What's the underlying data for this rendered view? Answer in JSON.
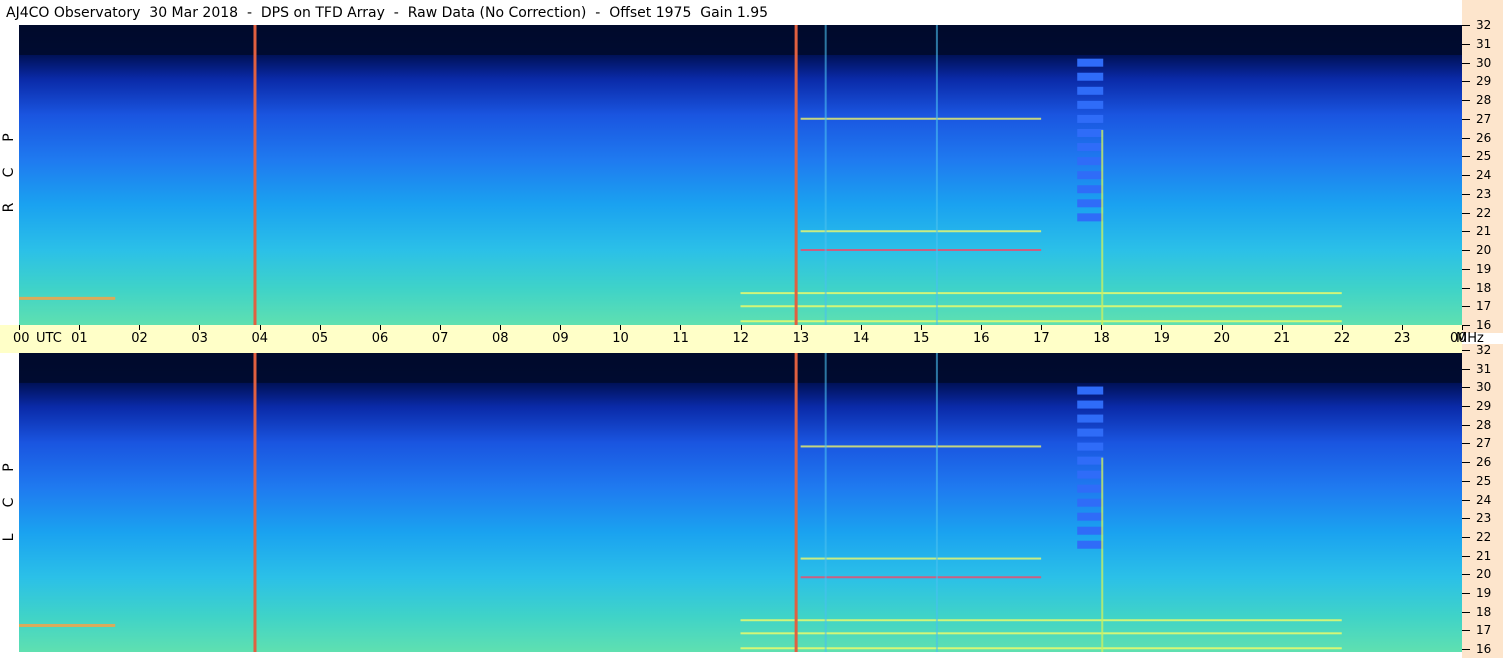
{
  "title": "AJ4CO Observatory  30 Mar 2018  -  DPS on TFD Array  -  Raw Data (No Correction)  -  Offset 1975  Gain 1.95",
  "panels": [
    {
      "polarization": "R C P",
      "letters": [
        "R",
        "C",
        "P"
      ]
    },
    {
      "polarization": "L C P",
      "letters": [
        "L",
        "C",
        "P"
      ]
    }
  ],
  "chart_data": {
    "type": "heatmap",
    "title": "AJ4CO Observatory  30 Mar 2018  -  DPS on TFD Array  -  Raw Data (No Correction)  -  Offset 1975  Gain 1.95",
    "x_axis": {
      "unit_label": "UTC",
      "range_hours": [
        0,
        24
      ],
      "tick_labels": [
        "00",
        "01",
        "02",
        "03",
        "04",
        "05",
        "06",
        "07",
        "08",
        "09",
        "10",
        "11",
        "12",
        "13",
        "14",
        "15",
        "16",
        "17",
        "18",
        "19",
        "20",
        "21",
        "22",
        "23",
        "00"
      ]
    },
    "y_axis": {
      "unit_label": "MHz",
      "range_mhz": [
        16,
        32
      ],
      "tick_labels": [
        "16",
        "17",
        "18",
        "19",
        "20",
        "21",
        "22",
        "23",
        "24",
        "25",
        "26",
        "27",
        "28",
        "29",
        "30",
        "31",
        "32"
      ]
    },
    "series": [
      {
        "name": "R C P"
      },
      {
        "name": "L C P"
      }
    ],
    "colormap": [
      "#000a33",
      "#001a80",
      "#0a3fd0",
      "#1f7af0",
      "#1aa2f0",
      "#3fd3c8",
      "#a8f070",
      "#ffff40",
      "#ff4040"
    ],
    "features": {
      "vertical_lines_utc": [
        3.9,
        12.9
      ],
      "faint_vertical_lines_utc": [
        13.4,
        15.25
      ],
      "pulsed_burst_utc": 17.8,
      "pulsed_burst_mhz_range": [
        21.5,
        30.5
      ],
      "strong_line_utc": 18.0,
      "horizontal_bands_mhz": [
        16.2,
        17.0,
        17.7,
        20.0,
        21.0,
        27.0
      ]
    }
  }
}
